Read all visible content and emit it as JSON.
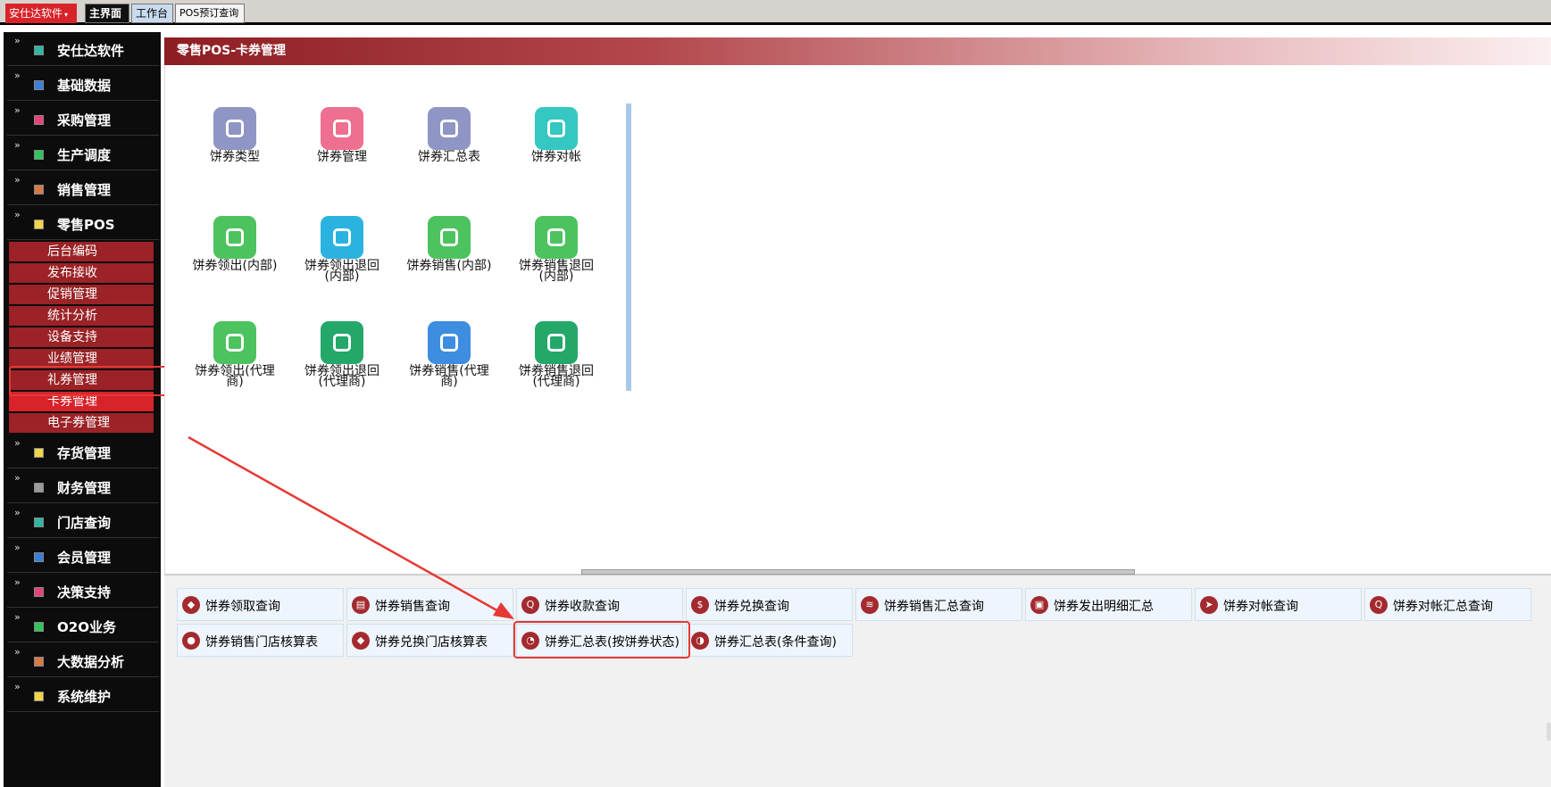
{
  "topbar": {
    "brand": "安仕达软件",
    "tabs": [
      "主界面",
      "工作台",
      "POS预订查询"
    ]
  },
  "sidebar": {
    "modules": [
      {
        "label": "安仕达软件",
        "color": "#2fb6a0"
      },
      {
        "label": "基础数据",
        "color": "#3b7fd6"
      },
      {
        "label": "采购管理",
        "color": "#e2447a"
      },
      {
        "label": "生产调度",
        "color": "#33c35d"
      },
      {
        "label": "销售管理",
        "color": "#d67a4a"
      },
      {
        "label": "零售POS",
        "color": "#f2d447"
      }
    ],
    "pos_subitems": [
      "后台编码",
      "发布接收",
      "促销管理",
      "统计分析",
      "设备支持",
      "业绩管理",
      "礼券管理",
      "卡券管理",
      "电子券管理"
    ],
    "active_subitem": "卡券管理",
    "modules_after": [
      {
        "label": "存货管理",
        "color": "#f2d447"
      },
      {
        "label": "财务管理",
        "color": "#9a9a9a"
      },
      {
        "label": "门店查询",
        "color": "#2fb6a0"
      },
      {
        "label": "会员管理",
        "color": "#3b7fd6"
      },
      {
        "label": "决策支持",
        "color": "#e2447a"
      },
      {
        "label": "O2O业务",
        "color": "#33c35d"
      },
      {
        "label": "大数据分析",
        "color": "#d67a4a"
      },
      {
        "label": "系统维护",
        "color": "#f2d447"
      }
    ]
  },
  "main": {
    "title": "零售POS-卡券管理",
    "tiles": [
      {
        "label": "饼券类型",
        "icon": "grid-icon",
        "color": "#8f95c4"
      },
      {
        "label": "饼券管理",
        "icon": "tag-icon",
        "color": "#ee6f8f"
      },
      {
        "label": "饼券汇总表",
        "icon": "server-icon",
        "color": "#8f95c4"
      },
      {
        "label": "饼券对帐",
        "icon": "pin-icon",
        "color": "#35c7c2"
      },
      {
        "label": "饼券领出(内部)",
        "icon": "upload-folder-icon",
        "color": "#4cc35f"
      },
      {
        "label": "饼券领出退回(内部)",
        "icon": "hand-icon",
        "color": "#2ab3e0"
      },
      {
        "label": "饼券销售(内部)",
        "icon": "return-icon",
        "color": "#4cc35f"
      },
      {
        "label": "饼券销售退回(内部)",
        "icon": "download-folder-icon",
        "color": "#4cc35f"
      },
      {
        "label": "饼券领出(代理商)",
        "icon": "flash-folder-icon",
        "color": "#4cc35f"
      },
      {
        "label": "饼券领出退回(代理商)",
        "icon": "house-icon",
        "color": "#23a86a"
      },
      {
        "label": "饼券销售(代理商)",
        "icon": "users-icon",
        "color": "#3d8de0"
      },
      {
        "label": "饼券销售退回(代理商)",
        "icon": "percent-badge-icon",
        "color": "#23a86a"
      }
    ]
  },
  "queries": [
    {
      "label": "饼券领取查询",
      "icon": "tag-icon",
      "glyph": "◆"
    },
    {
      "label": "饼券销售查询",
      "icon": "clipboard-icon",
      "glyph": "▤"
    },
    {
      "label": "饼券收款查询",
      "icon": "search-icon",
      "glyph": "Q"
    },
    {
      "label": "饼券兑换查询",
      "icon": "dollar-icon",
      "glyph": "$"
    },
    {
      "label": "饼券销售汇总查询",
      "icon": "layers-icon",
      "glyph": "≋"
    },
    {
      "label": "饼券发出明细汇总",
      "icon": "contact-icon",
      "glyph": "▣"
    },
    {
      "label": "饼券对帐查询",
      "icon": "send-icon",
      "glyph": "➤"
    },
    {
      "label": "饼券对帐汇总查询",
      "icon": "search-icon",
      "glyph": "Q"
    },
    {
      "label": "饼券销售门店核算表",
      "icon": "user-icon",
      "glyph": "●"
    },
    {
      "label": "饼券兑换门店核算表",
      "icon": "tag-icon",
      "glyph": "◆"
    },
    {
      "label": "饼券汇总表(按饼券状态)",
      "icon": "pie-icon",
      "glyph": "◔"
    },
    {
      "label": "饼券汇总表(条件查询)",
      "icon": "pie-icon",
      "glyph": "◑"
    }
  ],
  "annotation_color": "#e53935"
}
